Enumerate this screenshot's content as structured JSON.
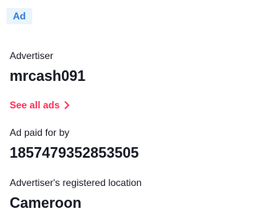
{
  "badge": {
    "label": "Ad"
  },
  "advertiser": {
    "label": "Advertiser",
    "name": "mrcash091",
    "see_all_label": "See all ads"
  },
  "paid_by": {
    "label": "Ad paid for by",
    "value": "1857479352853505"
  },
  "location": {
    "label": "Advertiser's registered location",
    "value": "Cameroon"
  },
  "colors": {
    "accent_link": "#fe2c55",
    "badge_text": "#2e7cd6",
    "badge_bg": "#eaf4fc",
    "text": "#161823"
  }
}
